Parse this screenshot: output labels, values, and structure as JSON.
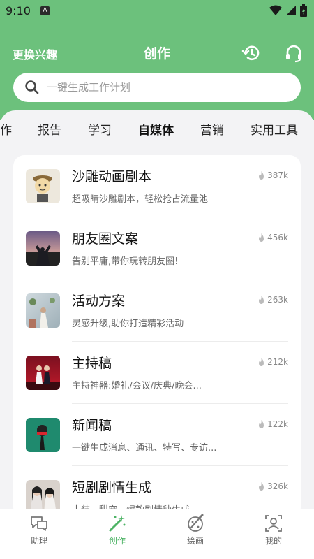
{
  "status": {
    "time": "9:10",
    "notif_badge": "A"
  },
  "header": {
    "left_label": "更换兴趣",
    "title": "创作",
    "history_icon": "history-icon",
    "support_icon": "headset-icon"
  },
  "search": {
    "placeholder": "一键生成工作计划"
  },
  "tabs": [
    {
      "label": "作",
      "active": false
    },
    {
      "label": "报告",
      "active": false
    },
    {
      "label": "学习",
      "active": false
    },
    {
      "label": "自媒体",
      "active": true
    },
    {
      "label": "营销",
      "active": false
    },
    {
      "label": "实用工具",
      "active": false
    }
  ],
  "items": [
    {
      "title": "沙雕动画剧本",
      "desc": "超吸睛沙雕剧本，轻松抢占流量池",
      "count": "387k"
    },
    {
      "title": "朋友圈文案",
      "desc": "告别平庸,带你玩转朋友圈!",
      "count": "456k"
    },
    {
      "title": "活动方案",
      "desc": "灵感升级,助你打造精彩活动",
      "count": "263k"
    },
    {
      "title": "主持稿",
      "desc": "主持神器:婚礼/会议/庆典/晚会...",
      "count": "212k"
    },
    {
      "title": "新闻稿",
      "desc": "一键生成消息、通讯、特写、专访...",
      "count": "122k"
    },
    {
      "title": "短剧剧情生成",
      "desc": "古装、甜宠、爆款剧情秒生成",
      "count": "326k"
    }
  ],
  "nav": [
    {
      "label": "助理",
      "icon": "chat-icon",
      "active": false
    },
    {
      "label": "创作",
      "icon": "magic-wand-icon",
      "active": true
    },
    {
      "label": "绘画",
      "icon": "paint-icon",
      "active": false
    },
    {
      "label": "我的",
      "icon": "profile-icon",
      "active": false
    }
  ],
  "colors": {
    "brand": "#6cc17c",
    "nav_active": "#4db365"
  }
}
